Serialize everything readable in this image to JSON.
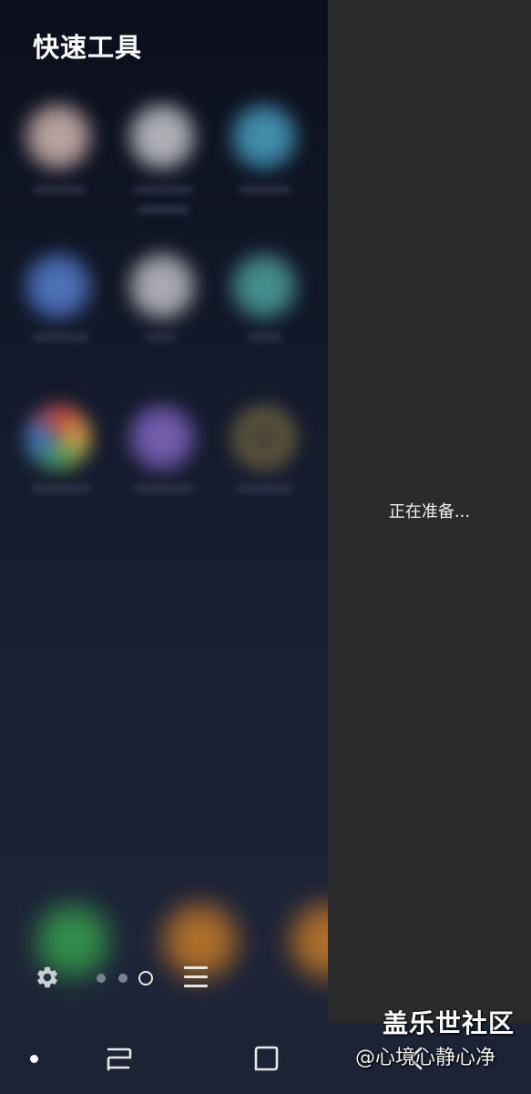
{
  "edge_panel": {
    "title": "快速工具",
    "settings_icon": "gear-icon",
    "menu_icon": "list-icon",
    "page_indicator": {
      "total": 3,
      "active_index": 2
    }
  },
  "right_panel": {
    "status_text": "正在准备..."
  },
  "navigation_bar": {
    "buttons": [
      "nav-dot-icon",
      "recents-icon",
      "home-icon",
      "back-icon"
    ]
  },
  "watermark": {
    "title": "盖乐世社区",
    "subtitle": "@心境心静心净"
  },
  "colors": {
    "right_panel_bg": "#2b2b2b",
    "nav_bar_bg": "#1b2335",
    "wallpaper_top": "#0b0f1c",
    "wallpaper_bottom": "#1d2437"
  }
}
